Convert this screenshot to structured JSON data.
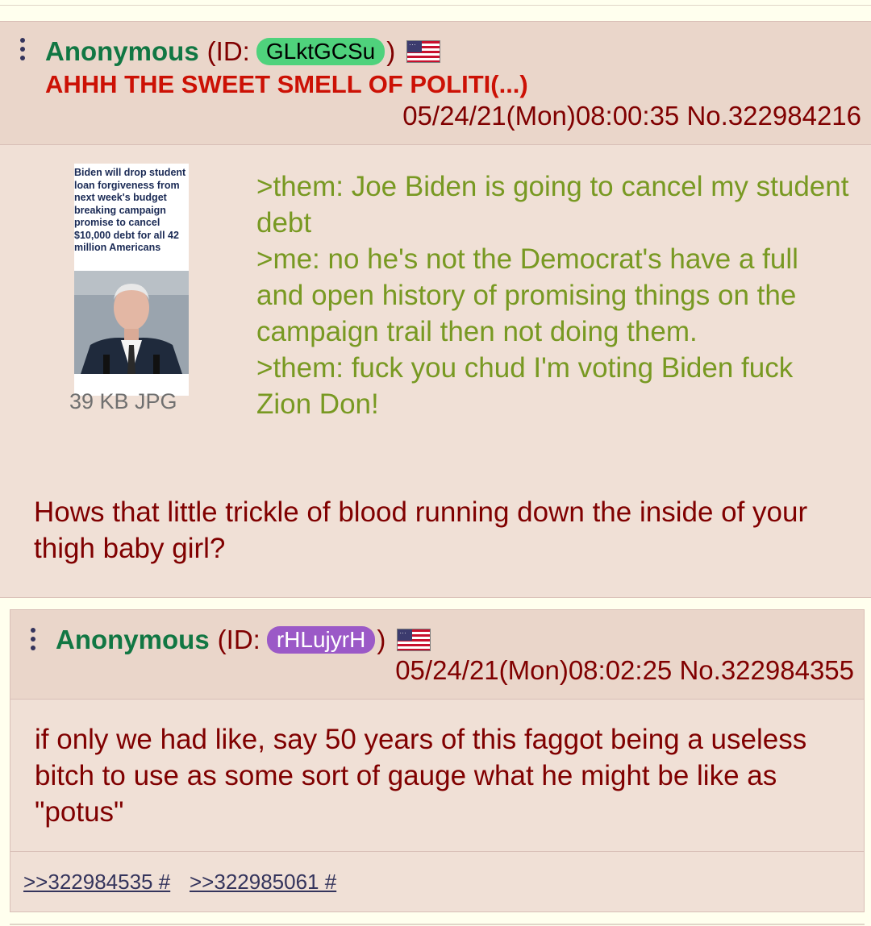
{
  "post1": {
    "name": "Anonymous",
    "id_open": "(ID:",
    "id": "GLktGCSu",
    "id_color": "#4fd27c",
    "id_close": ")",
    "flag": "us-flag-icon",
    "subject": "AHHH THE SWEET SMELL OF POLITI(...)",
    "date": "05/24/21(Mon)08:00:35",
    "post_no": "No.322984216",
    "thumbnail_text": "Biden will drop student loan forgiveness from next week's budget breaking campaign promise to cancel $10,000 debt for all 42 million Americans",
    "file_info": "39 KB JPG",
    "greentext": [
      ">them: Joe Biden is going to cancel my student debt",
      ">me: no he's not the Democrat's have a full and open history of promising things on the campaign trail then not doing them.",
      ">them: fuck you chud I'm voting Biden fuck Zion Don!"
    ],
    "body": "Hows that little trickle of blood running down the inside of your thigh baby girl?"
  },
  "post2": {
    "name": "Anonymous",
    "id_open": "(ID:",
    "id": "rHLujyrH",
    "id_color": "#9b59c7",
    "id_close": ")",
    "flag": "us-flag-icon",
    "date": "05/24/21(Mon)08:02:25",
    "post_no": "No.322984355",
    "body": "if only we had like, say 50 years of this faggot being a useless bitch to use as some sort of gauge what he might be like as \"potus\"",
    "backlinks": [
      ">>322984535 #",
      ">>322985061 #"
    ]
  }
}
